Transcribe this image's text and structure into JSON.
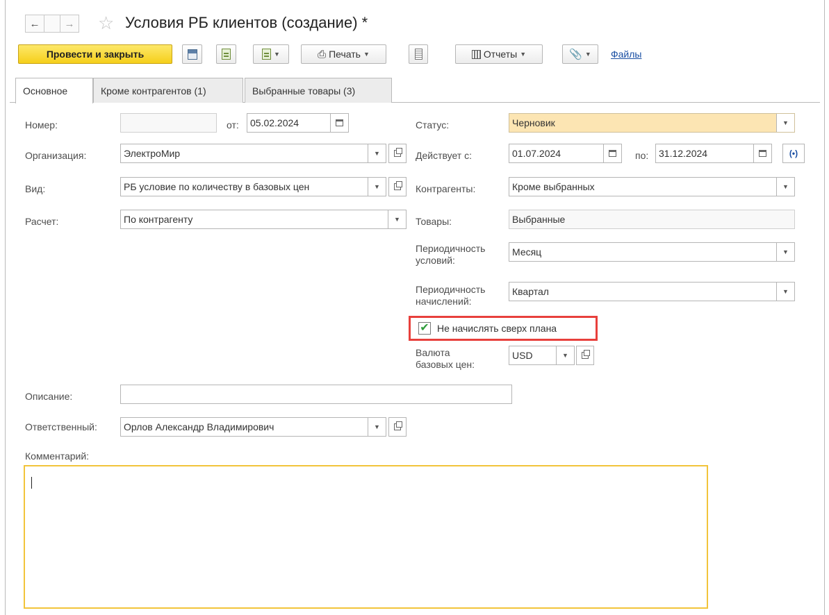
{
  "window": {
    "title": "Условия РБ клиентов (создание) *"
  },
  "toolbar": {
    "post_close_label": "Провести и закрыть",
    "print_label": "Печать",
    "reports_label": "Отчеты",
    "files_link": "Файлы"
  },
  "tabs": [
    {
      "label": "Основное",
      "active": true
    },
    {
      "label": "Кроме контрагентов (1)",
      "active": false
    },
    {
      "label": "Выбранные товары (3)",
      "active": false
    }
  ],
  "form": {
    "number_label": "Номер:",
    "number_value": "",
    "from_label": "от:",
    "from_value": "05.02.2024",
    "organization_label": "Организация:",
    "organization_value": "ЭлектроМир",
    "kind_label": "Вид:",
    "kind_value": "РБ условие по количеству в базовых цен",
    "calc_label": "Расчет:",
    "calc_value": "По контрагенту",
    "status_label": "Статус:",
    "status_value": "Черновик",
    "valid_from_label": "Действует с:",
    "valid_from_value": "01.07.2024",
    "valid_to_label": "по:",
    "valid_to_value": "31.12.2024",
    "counterparties_label": "Контрагенты:",
    "counterparties_value": "Кроме выбранных",
    "goods_label": "Товары:",
    "goods_value": "Выбранные",
    "period_cond_label_1": "Периодичность",
    "period_cond_label_2": "условий:",
    "period_cond_value": "Месяц",
    "period_accr_label_1": "Периодичность",
    "period_accr_label_2": "начислений:",
    "period_accr_value": "Квартал",
    "no_over_plan_label": "Не начислять сверх плана",
    "no_over_plan_checked": true,
    "currency_label_1": "Валюта",
    "currency_label_2": "базовых цен:",
    "currency_value": "USD",
    "description_label": "Описание:",
    "description_value": "",
    "responsible_label": "Ответственный:",
    "responsible_value": "Орлов Александр Владимирович",
    "comment_label": "Комментарий:",
    "comment_value": ""
  },
  "colors": {
    "primary_button": "#f5cf1a",
    "status_field": "#fce5b3",
    "highlight_box": "#e8403c",
    "comment_border": "#f2c43a",
    "checkmark": "#2f9c3b",
    "link": "#1a4fa3"
  },
  "icons": [
    "back-arrow-icon",
    "forward-arrow-icon",
    "favorite-star-icon",
    "save-icon",
    "post-icon",
    "create-based-on-icon",
    "printer-icon",
    "list-icon",
    "reports-icon",
    "attachment-icon",
    "calendar-icon",
    "open-icon",
    "sync-icon",
    "checkmark-icon",
    "dropdown-icon"
  ]
}
